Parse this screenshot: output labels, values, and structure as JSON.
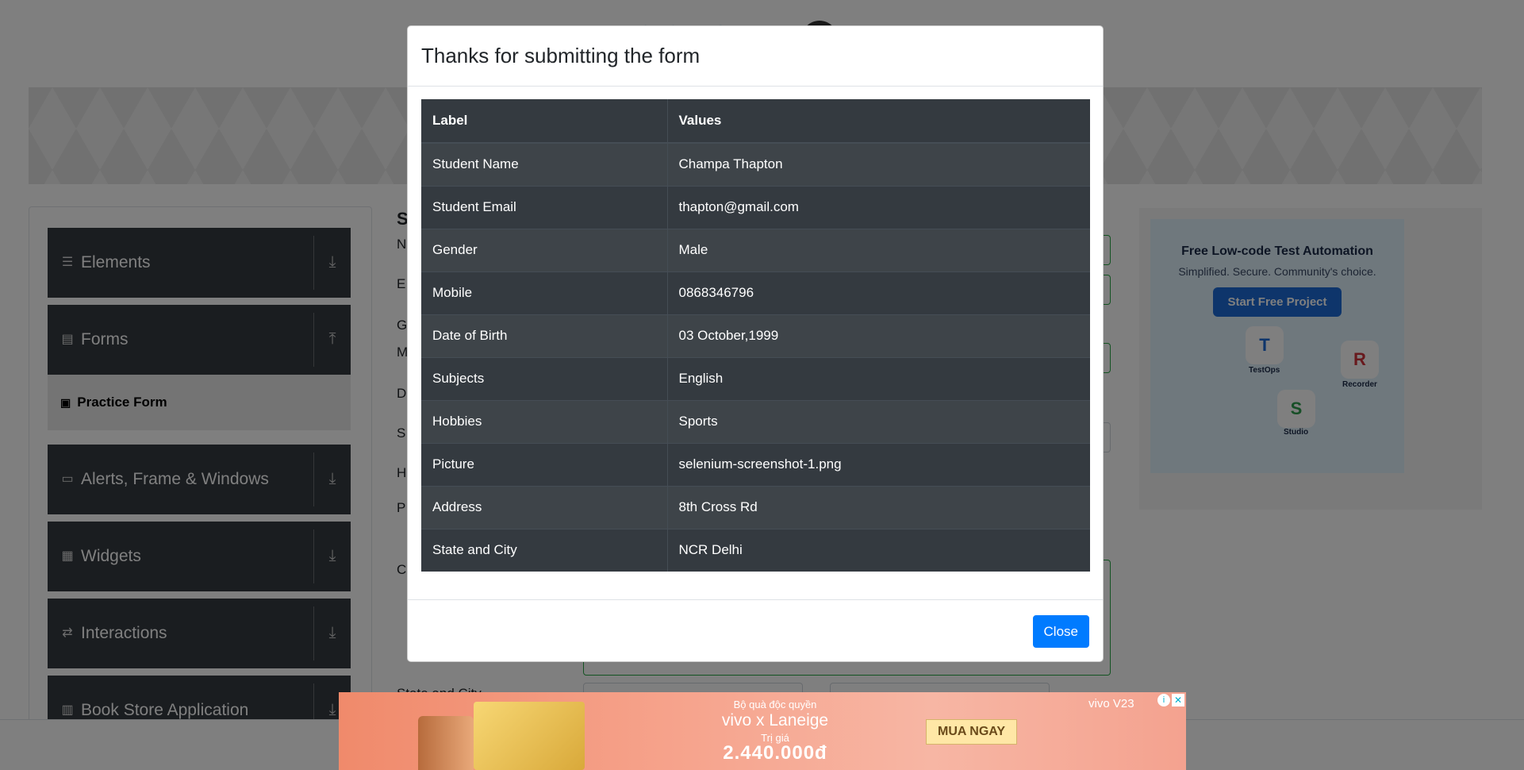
{
  "sidebar": {
    "groups": [
      {
        "label": "Elements",
        "icon": "list-icon",
        "arrow": "download-icon"
      },
      {
        "label": "Forms",
        "icon": "document-icon",
        "arrow": "upload-icon"
      },
      {
        "label": "Alerts, Frame & Windows",
        "icon": "window-icon",
        "arrow": "download-icon"
      },
      {
        "label": "Widgets",
        "icon": "widgets-icon",
        "arrow": "download-icon"
      },
      {
        "label": "Interactions",
        "icon": "interactions-icon",
        "arrow": "download-icon"
      },
      {
        "label": "Book Store Application",
        "icon": "books-icon",
        "arrow": "download-icon"
      }
    ],
    "active_item": "Practice Form"
  },
  "form_labels_partial": [
    "S",
    "N",
    "E",
    "G",
    "M",
    "D",
    "S",
    "H",
    "P",
    "C",
    "State and City"
  ],
  "side_ad": {
    "title": "Free Low-code Test Automation",
    "subtitle": "Simplified. Secure. Community's choice.",
    "button": "Start Free Project",
    "apps": [
      {
        "letter": "T",
        "label": "TestOps"
      },
      {
        "letter": "R",
        "label": "Recorder"
      },
      {
        "letter": "S",
        "label": "Studio"
      }
    ]
  },
  "bottom_ad": {
    "line1": "Bộ quà độc quyền",
    "line2": "vivo x Laneige",
    "line3": "Trị giá",
    "price": "2.440.000đ",
    "cta": "MUA NGAY",
    "brand": "vivo V23"
  },
  "modal": {
    "title": "Thanks for submitting the form",
    "table": {
      "headers": [
        "Label",
        "Values"
      ],
      "rows": [
        [
          "Student Name",
          "Champa Thapton"
        ],
        [
          "Student Email",
          "thapton@gmail.com"
        ],
        [
          "Gender",
          "Male"
        ],
        [
          "Mobile",
          "0868346796"
        ],
        [
          "Date of Birth",
          "03 October,1999"
        ],
        [
          "Subjects",
          "English"
        ],
        [
          "Hobbies",
          "Sports"
        ],
        [
          "Picture",
          "selenium-screenshot-1.png"
        ],
        [
          "Address",
          "8th Cross Rd"
        ],
        [
          "State and City",
          "NCR Delhi"
        ]
      ]
    },
    "close_label": "Close"
  },
  "colors": {
    "table_bg": "#343a40",
    "primary": "#007bff",
    "backdrop": "rgba(0,0,0,0.5)"
  }
}
